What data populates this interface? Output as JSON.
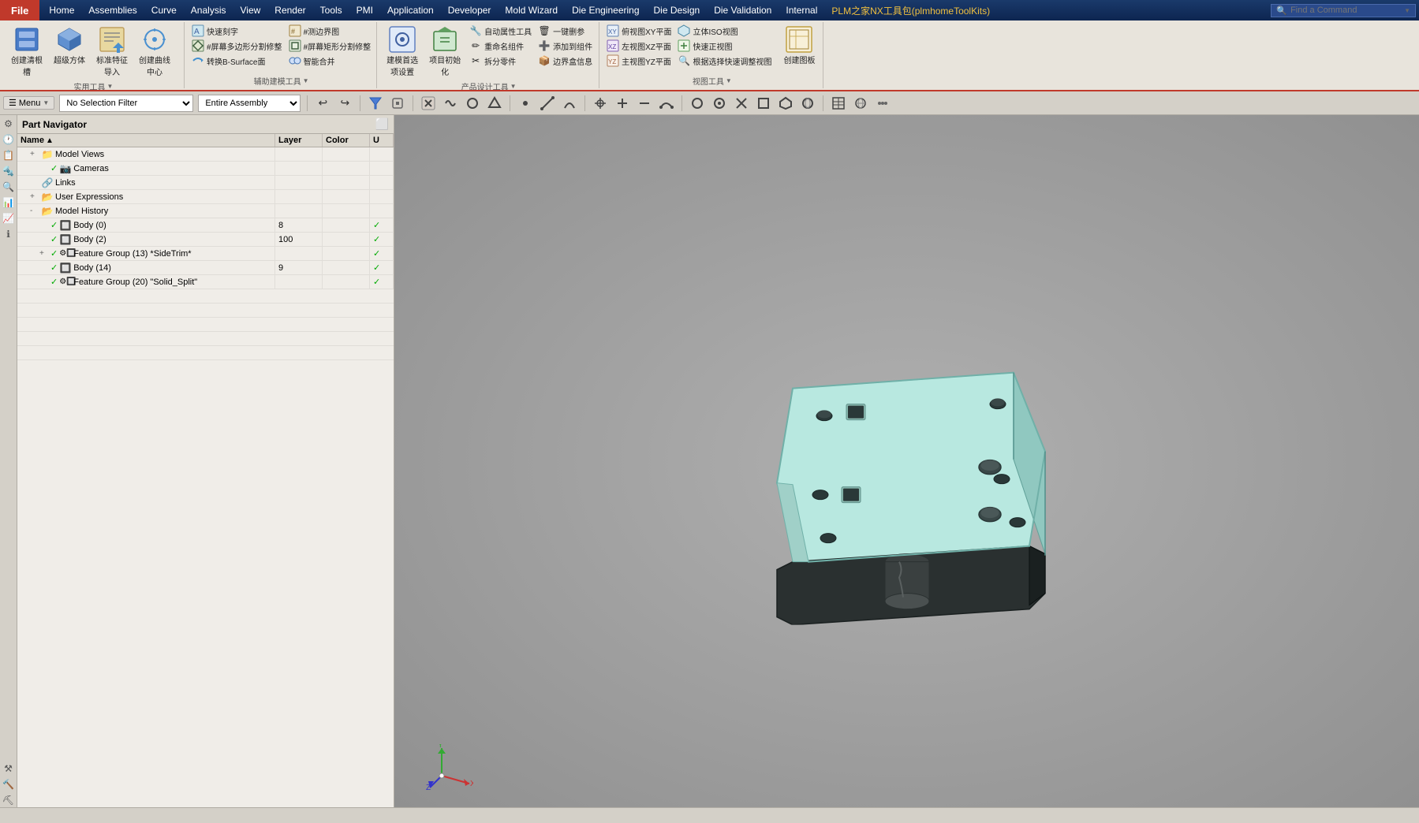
{
  "titlebar": {
    "file_label": "File",
    "menus": [
      "Home",
      "Assemblies",
      "Curve",
      "Analysis",
      "View",
      "Render",
      "Tools",
      "PMI",
      "Application",
      "Developer",
      "Mold Wizard",
      "Die Engineering",
      "Die Design",
      "Die Validation",
      "Internal"
    ],
    "plugin_label": "PLM之家NX工具包(plmhomeToolKits)",
    "find_command_placeholder": "Find a Command"
  },
  "ribbon": {
    "groups": [
      {
        "id": "practical",
        "label": "实用工具",
        "items_large": [
          {
            "id": "create-clear-root",
            "label": "创建清根槽",
            "icon": "⬛"
          },
          {
            "id": "super-cube",
            "label": "超级方体",
            "icon": "🟦"
          },
          {
            "id": "standard-feature-guide",
            "label": "标准特征导入",
            "icon": "📋"
          },
          {
            "id": "create-curve-center",
            "label": "创建曲线中心",
            "icon": "⭕"
          }
        ]
      },
      {
        "id": "aux-model",
        "label": "辅助建模工具",
        "items_small": [
          {
            "id": "quick-engrave",
            "label": "快速刻字",
            "icon": "✏"
          },
          {
            "id": "screen-poly-split",
            "label": "#屏幕多边形分割修整",
            "icon": "#"
          },
          {
            "id": "convert-b-surface",
            "label": "转换B-Surface面",
            "icon": "⇄"
          },
          {
            "id": "measure-border",
            "label": "#测边界图",
            "icon": "#"
          },
          {
            "id": "screen-rect-split",
            "label": "#屏幕矩形分割修整",
            "icon": "#"
          },
          {
            "id": "smart-merge",
            "label": "智能合并",
            "icon": "🔗"
          }
        ]
      },
      {
        "id": "product-design",
        "label": "产品设计工具",
        "items_large": [
          {
            "id": "build-model-settings",
            "label": "建模首选项设置",
            "icon": "⚙"
          },
          {
            "id": "project-init",
            "label": "项目初始化",
            "icon": "🏗"
          }
        ],
        "items_small": [
          {
            "id": "auto-property-tool",
            "label": "自动属性工具",
            "icon": "🔧"
          },
          {
            "id": "rename-part",
            "label": "重命名组件",
            "icon": "✏"
          },
          {
            "id": "disassemble-part",
            "label": "拆分零件",
            "icon": "✂"
          },
          {
            "id": "one-click-ref",
            "label": "一键删参",
            "icon": "🗑"
          },
          {
            "id": "add-to-group",
            "label": "添加到组件",
            "icon": "➕"
          },
          {
            "id": "bbox-info",
            "label": "边界盒信息",
            "icon": "📦"
          }
        ]
      },
      {
        "id": "view-tools",
        "label": "视图工具",
        "items_small": [
          {
            "id": "top-xy-view",
            "label": "俯视图XY平面",
            "icon": "⬆"
          },
          {
            "id": "iso-view",
            "label": "立体ISO视图",
            "icon": "🔷"
          },
          {
            "id": "left-xz-view",
            "label": "左视图XZ平面",
            "icon": "◀"
          },
          {
            "id": "front-view",
            "label": "快速正视图",
            "icon": "⏺"
          },
          {
            "id": "main-yz-view",
            "label": "主视图YZ平面",
            "icon": "▶"
          },
          {
            "id": "quick-adjust-view",
            "label": "根据选择快速调整视图",
            "icon": "🔍"
          }
        ],
        "items_large2": [
          {
            "id": "create-drawing",
            "label": "创建图板",
            "icon": "📄"
          }
        ]
      }
    ]
  },
  "commandbar": {
    "menu_label": "Menu",
    "selection_filter": "No Selection Filter",
    "assembly_filter": "Entire Assembly",
    "icons": [
      "↩",
      "↪",
      "↖",
      "🔲",
      "◈",
      "⬡",
      "⬟",
      "○",
      "⊕",
      "＋",
      "━",
      "◐",
      "◑",
      "⬛",
      "●",
      "⬤",
      "◉",
      "▣",
      "◫",
      "⊙",
      "⊘"
    ]
  },
  "part_navigator": {
    "title": "Part Navigator",
    "columns": [
      "Name",
      "Layer",
      "Color",
      "U"
    ],
    "rows": [
      {
        "indent": 1,
        "expand": "+",
        "icon": "folder",
        "name": "Model Views",
        "layer": "",
        "color": "",
        "check": false
      },
      {
        "indent": 2,
        "expand": "",
        "icon": "camera",
        "name": "Cameras",
        "layer": "",
        "color": "",
        "check": false
      },
      {
        "indent": 1,
        "expand": "",
        "icon": "folder",
        "name": "Links",
        "layer": "",
        "color": "",
        "check": false
      },
      {
        "indent": 1,
        "expand": "+",
        "icon": "folder",
        "name": "User Expressions",
        "layer": "",
        "color": "",
        "check": false
      },
      {
        "indent": 1,
        "expand": "-",
        "icon": "folder",
        "name": "Model History",
        "layer": "",
        "color": "",
        "check": false
      },
      {
        "indent": 2,
        "expand": "",
        "icon": "body",
        "name": "Body (0)",
        "layer": "8",
        "color": "",
        "check": true
      },
      {
        "indent": 2,
        "expand": "",
        "icon": "body",
        "name": "Body (2)",
        "layer": "100",
        "color": "",
        "check": true
      },
      {
        "indent": 2,
        "expand": "+",
        "icon": "feature-group",
        "name": "Feature Group (13) *SideTrim*",
        "layer": "",
        "color": "",
        "check": true
      },
      {
        "indent": 2,
        "expand": "",
        "icon": "body",
        "name": "Body (14)",
        "layer": "9",
        "color": "",
        "check": true
      },
      {
        "indent": 2,
        "expand": "",
        "icon": "feature-group",
        "name": "Feature Group (20) \"Solid_Split\"",
        "layer": "",
        "color": "",
        "check": true
      }
    ]
  },
  "viewport": {
    "background_color": "#a0a8a8",
    "model_color": "#b8e8e0",
    "model_bottom_color": "#2a3030"
  },
  "statusbar": {
    "text": ""
  }
}
